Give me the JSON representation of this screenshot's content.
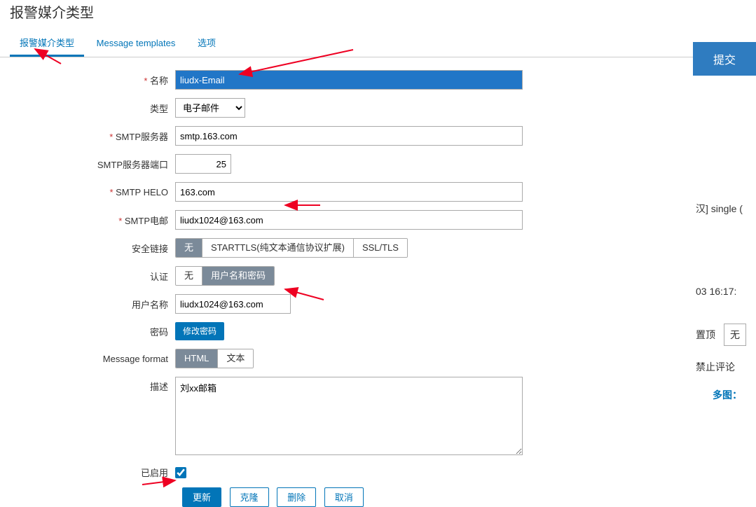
{
  "page": {
    "title": "报警媒介类型"
  },
  "tabs": {
    "media_type": "报警媒介类型",
    "templates": "Message templates",
    "options": "选项"
  },
  "labels": {
    "name": "名称",
    "type": "类型",
    "smtp_server": "SMTP服务器",
    "smtp_port": "SMTP服务器端口",
    "smtp_helo": "SMTP HELO",
    "smtp_email": "SMTP电邮",
    "security": "安全链接",
    "auth": "认证",
    "username": "用户名称",
    "password": "密码",
    "msg_format": "Message format",
    "description": "描述",
    "enabled": "已启用"
  },
  "values": {
    "name": "liudx-Email",
    "type": "电子邮件",
    "smtp_server": "smtp.163.com",
    "smtp_port": "25",
    "smtp_helo": "163.com",
    "smtp_email": "liudx1024@163.com",
    "username": "liudx1024@163.com",
    "desc_prefix": "刘xx",
    "description": "邮箱"
  },
  "segments": {
    "security": {
      "none": "无",
      "starttls": "STARTTLS(纯文本通信协议扩展)",
      "ssltls": "SSL/TLS"
    },
    "auth": {
      "none": "无",
      "userpass": "用户名和密码"
    },
    "msgfmt": {
      "html": "HTML",
      "text": "文本"
    }
  },
  "buttons": {
    "change_pw": "修改密码",
    "update": "更新",
    "clone": "克隆",
    "delete": "删除",
    "cancel": "取消"
  },
  "side": {
    "submit": "提交",
    "single": "汉] single (",
    "time": "03 16:17:",
    "pin": "置顶",
    "pin_val": "无",
    "block": "禁止评论",
    "multi": "多图："
  }
}
